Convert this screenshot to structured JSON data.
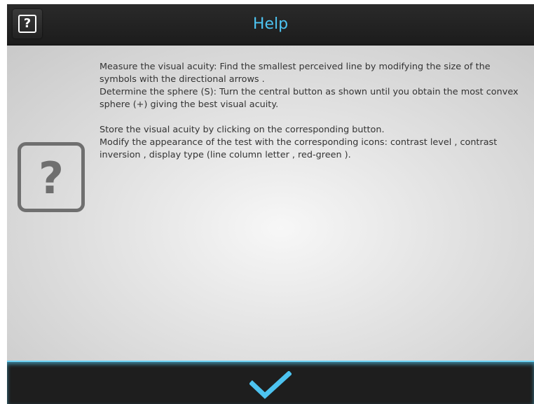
{
  "header": {
    "title": "Help",
    "help_icon": "question-mark-icon",
    "title_color": "#4dc3f0"
  },
  "content": {
    "icon": "question-mark-icon",
    "paragraphs": [
      "Measure the visual acuity: Find the smallest perceived line by modifying the size of the symbols with the directional arrows .",
      "Determine the sphere (S): Turn the central button as shown until you obtain the most convex sphere (+) giving the best visual acuity.",
      "",
      "Store the visual acuity by clicking on the corresponding button.",
      "Modify the appearance of the test with the corresponding icons: contrast level , contrast inversion , display type (line column letter , red-green )."
    ]
  },
  "footer": {
    "confirm_icon": "checkmark-icon",
    "accent_color": "#4dc3f0"
  }
}
